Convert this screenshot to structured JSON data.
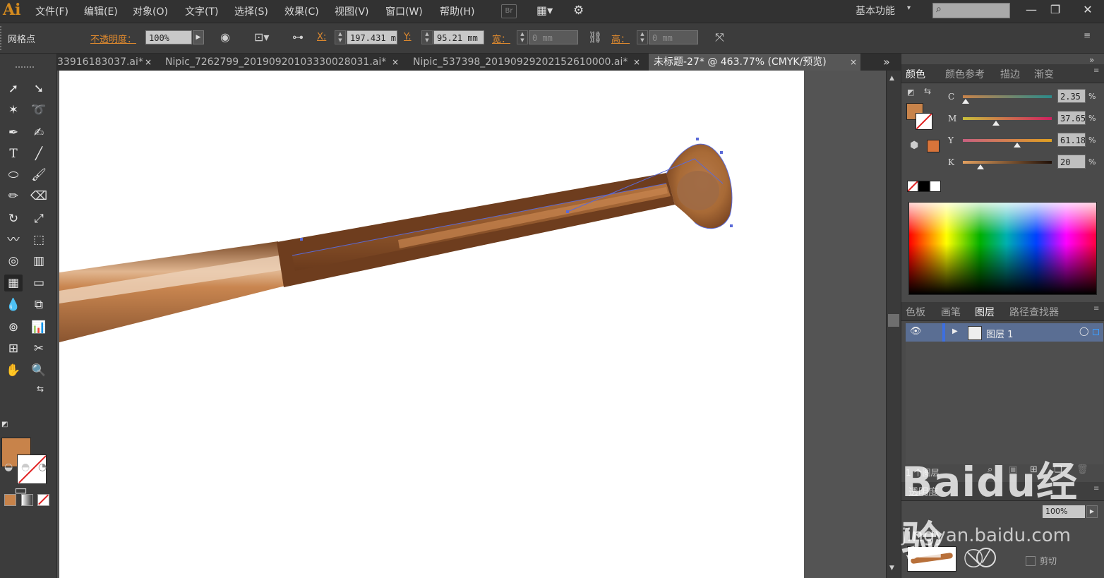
{
  "app": {
    "logo": "Ai"
  },
  "menu": [
    "文件(F)",
    "编辑(E)",
    "对象(O)",
    "文字(T)",
    "选择(S)",
    "效果(C)",
    "视图(V)",
    "窗口(W)",
    "帮助(H)"
  ],
  "menubar_icons": {
    "bridge": "Br",
    "arrange": "arrange-documents-icon",
    "gpu": "gpu-performance-icon"
  },
  "workspace": {
    "label": "基本功能",
    "caret": "▾"
  },
  "search": {
    "placeholder": "",
    "icon": "⌕"
  },
  "window_controls": {
    "minimize": "—",
    "restore": "❐",
    "close": "✕"
  },
  "controlbar": {
    "tool_name": "网格点",
    "opacity_label": "不透明度：",
    "opacity_value": "100%",
    "x_label": "X:",
    "x_value": "197.431 m",
    "y_label": "Y:",
    "y_value": "95.21 mm",
    "width_label": "宽：",
    "width_value": "0 mm",
    "height_label": "高：",
    "height_value": "0 mm"
  },
  "tabs": [
    {
      "label": "33916183037.ai*",
      "active": false
    },
    {
      "label": "Nipic_7262799_20190920103330028031.ai*",
      "active": false
    },
    {
      "label": "Nipic_537398_20190929202152610000.ai*",
      "active": false
    },
    {
      "label": "未标题-27* @ 463.77% (CMYK/预览)",
      "active": true
    }
  ],
  "tab_close": "×",
  "tab_overflow": "»",
  "color_panel": {
    "tabs": [
      "颜色",
      "颜色参考",
      "描边",
      "渐变"
    ],
    "active_tab": "颜色",
    "fill_color": "#c8834a",
    "out_of_gamut_color": "#d8743a",
    "channels": [
      {
        "label": "C",
        "value": "2.35",
        "fraction": 0.0235
      },
      {
        "label": "M",
        "value": "37.65",
        "fraction": 0.3765
      },
      {
        "label": "Y",
        "value": "61.18",
        "fraction": 0.6118
      },
      {
        "label": "K",
        "value": "20",
        "fraction": 0.2
      }
    ],
    "percent": "%"
  },
  "layers_panel": {
    "tabs": [
      "色板",
      "画笔",
      "图层",
      "路径查找器"
    ],
    "active_tab": "图层",
    "layers": [
      {
        "name": "图层 1"
      }
    ],
    "count": "1 个图层"
  },
  "transparency_panel": {
    "title": "透明度",
    "opacity": "100%",
    "clip_label": "剪切"
  },
  "watermark": {
    "text": "Baidu经验",
    "subtext": "jingyan.baidu.com"
  },
  "colors": {
    "accent_orange": "#e08a2e",
    "bat_highlight": "#c98650",
    "bat_dark": "#7a4422"
  }
}
